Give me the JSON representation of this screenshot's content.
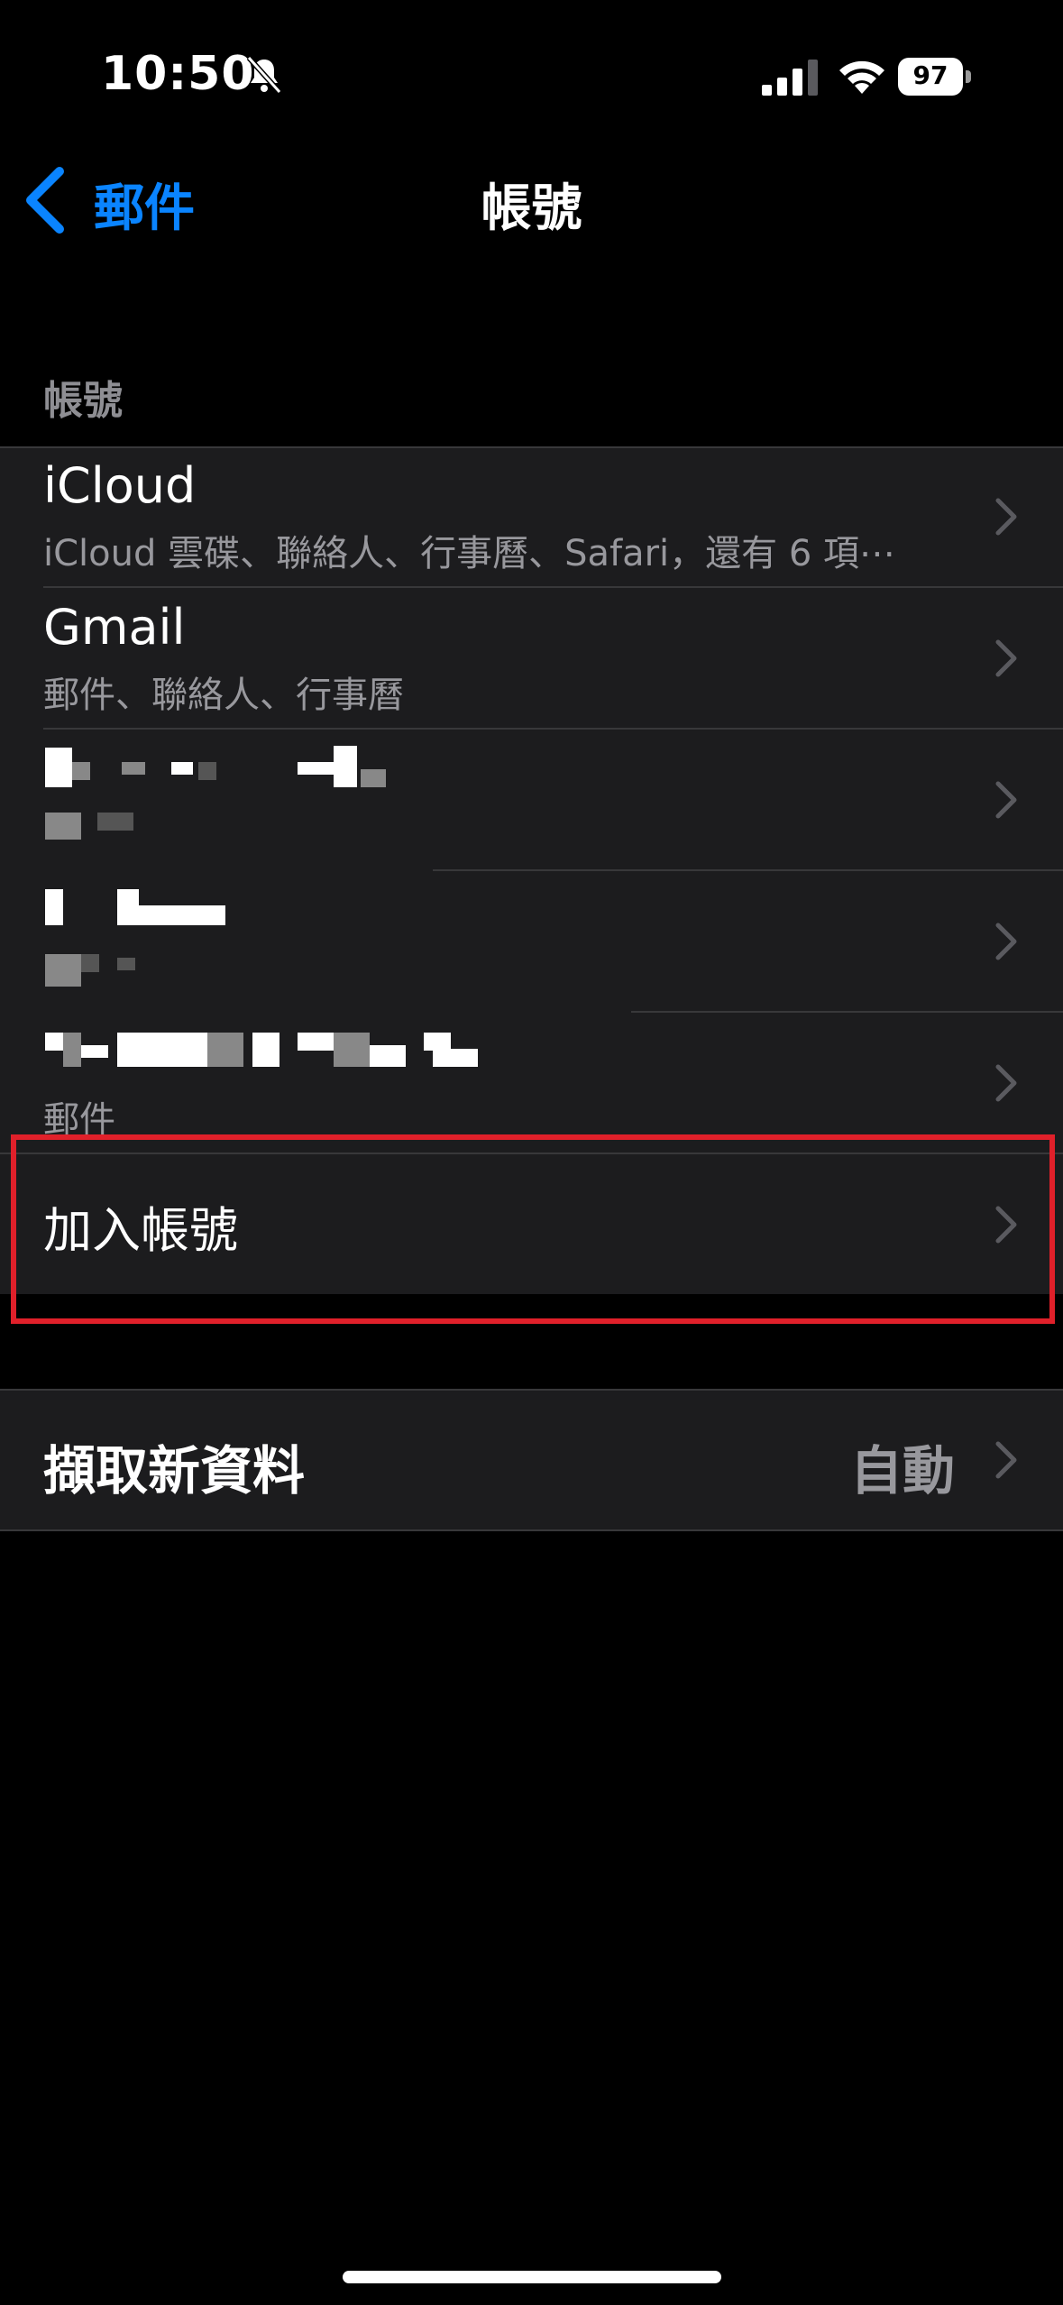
{
  "status_bar": {
    "time": "10:50",
    "battery": "97"
  },
  "nav": {
    "back_label": "郵件",
    "title": "帳號"
  },
  "accounts_section": {
    "header": "帳號",
    "items": [
      {
        "title": "iCloud",
        "subtitle": "iCloud 雲碟、聯絡人、行事曆、Safari，還有 6 項⋯"
      },
      {
        "title": "Gmail",
        "subtitle": "郵件、聯絡人、行事曆"
      },
      {
        "title": "",
        "subtitle": ""
      },
      {
        "title": "",
        "subtitle": ""
      },
      {
        "title": "",
        "subtitle": "郵件"
      }
    ],
    "add_account": "加入帳號"
  },
  "fetch": {
    "label": "擷取新資料",
    "value": "自動"
  },
  "colors": {
    "accent": "#0a84ff",
    "highlight": "#e0202a",
    "cell": "#1c1c1e"
  },
  "icons": [
    "bell-slash-icon",
    "signal-icon",
    "wifi-icon",
    "battery-icon",
    "chevron-left-icon",
    "chevron-right-icon"
  ]
}
